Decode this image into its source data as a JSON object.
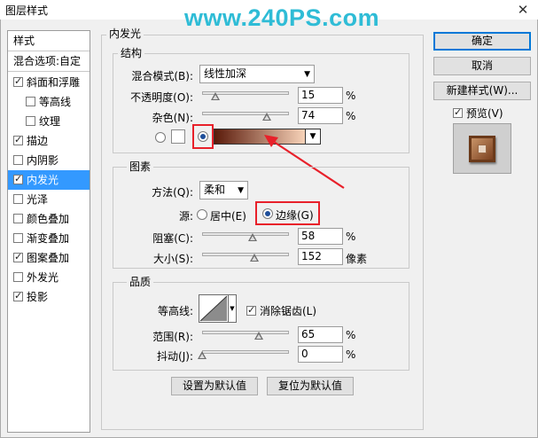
{
  "window": {
    "title": "图层样式",
    "close_glyph": "✕",
    "watermark": "www.240PS.com"
  },
  "sidebar": {
    "items": [
      {
        "label": "样式",
        "checkbox": null
      },
      {
        "label": "混合选项:自定",
        "checkbox": null
      },
      {
        "label": "斜面和浮雕",
        "checkbox": true
      },
      {
        "label": "等高线",
        "checkbox": false
      },
      {
        "label": "纹理",
        "checkbox": false
      },
      {
        "label": "描边",
        "checkbox": true
      },
      {
        "label": "内阴影",
        "checkbox": false
      },
      {
        "label": "内发光",
        "checkbox": true,
        "selected": true
      },
      {
        "label": "光泽",
        "checkbox": false
      },
      {
        "label": "颜色叠加",
        "checkbox": false
      },
      {
        "label": "渐变叠加",
        "checkbox": false
      },
      {
        "label": "图案叠加",
        "checkbox": true
      },
      {
        "label": "外发光",
        "checkbox": false
      },
      {
        "label": "投影",
        "checkbox": true
      }
    ]
  },
  "main": {
    "panel_title": "内发光",
    "structure": {
      "title": "结构",
      "blend_mode_label": "混合模式(B):",
      "blend_mode_value": "线性加深",
      "opacity_label": "不透明度(O):",
      "opacity_value": "15",
      "opacity_unit": "%",
      "opacity_level": 0.15,
      "noise_label": "杂色(N):",
      "noise_value": "74",
      "noise_unit": "%",
      "noise_level": 0.74,
      "color_mode": "gradient",
      "gradient_colors": [
        "#5a1a0a",
        "#f7d2b8"
      ]
    },
    "elements": {
      "title": "图素",
      "technique_label": "方法(Q):",
      "technique_value": "柔和",
      "source_label": "源:",
      "source_center_label": "居中(E)",
      "source_edge_label": "边缘(G)",
      "source_selected": "edge",
      "choke_label": "阻塞(C):",
      "choke_value": "58",
      "choke_unit": "%",
      "choke_level": 0.58,
      "size_label": "大小(S):",
      "size_value": "152",
      "size_unit": "像素",
      "size_level": 0.6
    },
    "quality": {
      "title": "品质",
      "contour_label": "等高线:",
      "antialias_label": "消除锯齿(L)",
      "antialias_checked": true,
      "range_label": "范围(R):",
      "range_value": "65",
      "range_unit": "%",
      "range_level": 0.65,
      "jitter_label": "抖动(J):",
      "jitter_value": "0",
      "jitter_unit": "%",
      "jitter_level": 0.0
    },
    "set_default_label": "设置为默认值",
    "reset_default_label": "复位为默认值"
  },
  "actions": {
    "ok_label": "确定",
    "cancel_label": "取消",
    "new_style_label": "新建样式(W)...",
    "preview_label": "预览(V)",
    "preview_checked": true
  },
  "colors": {
    "selection": "#3399ff",
    "highlight": "#e8202a",
    "watermark": "#2fbcd6"
  }
}
